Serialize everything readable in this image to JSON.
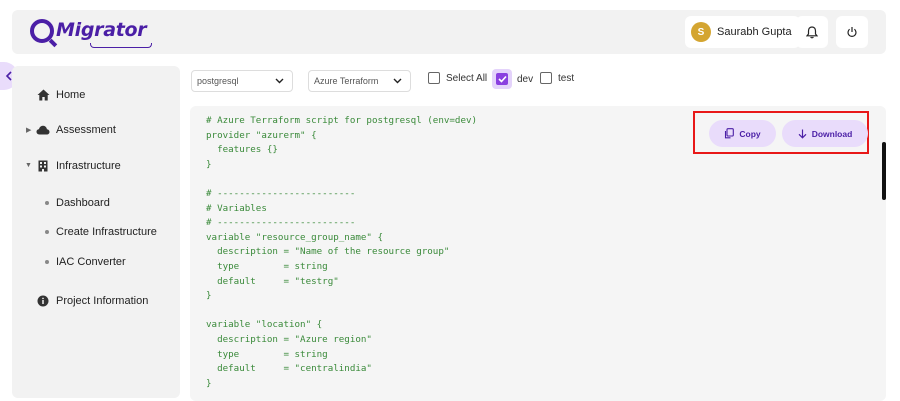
{
  "app": {
    "logo_text": "Migrator"
  },
  "header": {
    "user_initial": "S",
    "user_name": "Saurabh Gupta"
  },
  "sidebar": {
    "items": [
      {
        "label": "Home"
      },
      {
        "label": "Assessment"
      },
      {
        "label": "Infrastructure"
      },
      {
        "label": "Project Information"
      }
    ],
    "sub_items": [
      {
        "label": "Dashboard"
      },
      {
        "label": "Create Infrastructure"
      },
      {
        "label": "IAC Converter"
      }
    ]
  },
  "toolbar": {
    "database_select": "postgresql",
    "provider_select": "Azure Terraform",
    "checkboxes": [
      {
        "label": "Select All",
        "checked": false
      },
      {
        "label": "dev",
        "checked": true
      },
      {
        "label": "test",
        "checked": false
      }
    ]
  },
  "actions": {
    "copy_label": "Copy",
    "download_label": "Download"
  },
  "code": {
    "lines": [
      "# Azure Terraform script for postgresql (env=dev)",
      "provider \"azurerm\" {",
      "  features {}",
      "}",
      "",
      "# -------------------------",
      "# Variables",
      "# -------------------------",
      "variable \"resource_group_name\" {",
      "  description = \"Name of the resource group\"",
      "  type        = string",
      "  default     = \"testrg\"",
      "}",
      "",
      "variable \"location\" {",
      "  description = \"Azure region\"",
      "  type        = string",
      "  default     = \"centralindia\"",
      "}"
    ]
  },
  "colors": {
    "brand": "#4b1fa6",
    "accent": "#8a3fe0",
    "button_bg": "#e9dcfb",
    "code_text": "#3a8a3a",
    "highlight": "#e81818"
  },
  "icons": {
    "home": "home-icon",
    "assessment": "cloud-icon",
    "infrastructure": "building-icon",
    "project_info": "info-icon",
    "notifications": "bell-icon",
    "logout": "power-icon",
    "copy": "copy-icon",
    "download": "download-arrow-icon"
  }
}
